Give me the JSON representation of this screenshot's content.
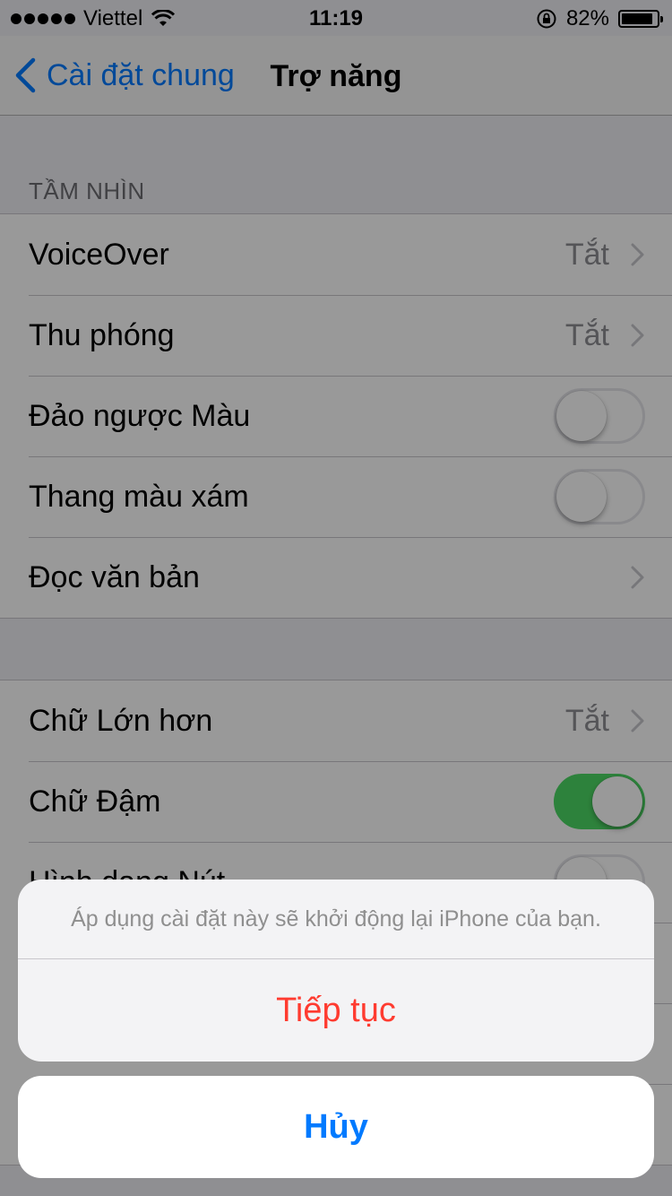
{
  "status_bar": {
    "carrier": "Viettel",
    "time": "11:19",
    "battery_percent": "82%",
    "battery_level": 0.82,
    "icons": [
      "signal-dots-icon",
      "wifi-icon",
      "orientation-lock-icon",
      "battery-icon"
    ]
  },
  "navbar": {
    "back_label": "Cài đặt chung",
    "title": "Trợ năng"
  },
  "section_vision": {
    "header": "TẦM NHÌN",
    "rows": [
      {
        "label": "VoiceOver",
        "value": "Tắt"
      },
      {
        "label": "Thu phóng",
        "value": "Tắt"
      },
      {
        "label": "Đảo ngược Màu",
        "toggle": false
      },
      {
        "label": "Thang màu xám",
        "toggle": false
      },
      {
        "label": "Đọc văn bản"
      }
    ]
  },
  "section_text": {
    "rows": [
      {
        "label": "Chữ Lớn hơn",
        "value": "Tắt"
      },
      {
        "label": "Chữ Đậm",
        "toggle": true
      },
      {
        "label": "Hình dạng Nút",
        "toggle": false
      }
    ]
  },
  "action_sheet": {
    "message": "Áp dụng cài đặt này sẽ khởi động lại iPhone của bạn.",
    "continue_label": "Tiếp tục",
    "cancel_label": "Hủy"
  },
  "colors": {
    "accent": "#007aff",
    "destructive": "#ff3b30",
    "switch_on": "#4cd964"
  }
}
